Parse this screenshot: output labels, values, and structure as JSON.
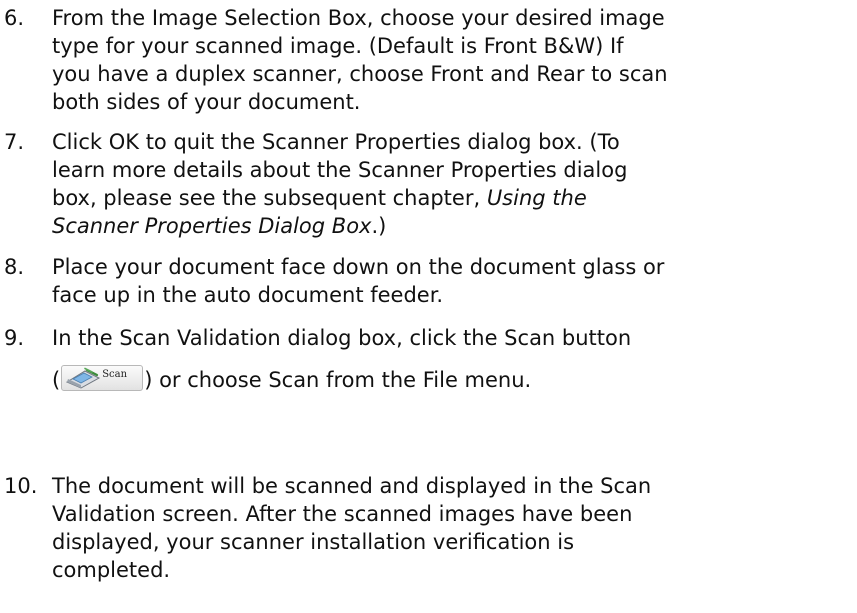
{
  "steps": [
    {
      "num": "6.",
      "lines": [
        "From the Image Selection Box, choose your desired image",
        "type for your scanned image.  (Default is Front B&W)  If",
        "you have a duplex scanner, choose Front and Rear to scan",
        "both sides of your document."
      ]
    },
    {
      "num": "7.",
      "line1": "Click OK to quit the Scanner Properties dialog box.  (To",
      "line2": "learn more details about the Scanner Properties dialog",
      "line3_prefix": "box, please see the subsequent chapter, ",
      "line3_italic": "Using the",
      "line4_italic": "Scanner Properties Dialog Box",
      "line4_suffix": ".)"
    },
    {
      "num": "8.",
      "lines": [
        "Place your document face down on the document glass or",
        "face up in the auto document feeder."
      ]
    },
    {
      "num": "9.",
      "line1": "In the Scan Validation dialog box, click the Scan button",
      "paren_open": "(",
      "scan_button_label": "Scan",
      "line2_suffix": ") or choose Scan from the File menu."
    },
    {
      "num": "10.",
      "lines": [
        "The document will be scanned and displayed in the Scan",
        "Validation screen.  After the scanned images have been",
        "displayed, your scanner installation verification is",
        "completed."
      ]
    }
  ],
  "icons": {
    "scan_button": "scanner-icon"
  }
}
